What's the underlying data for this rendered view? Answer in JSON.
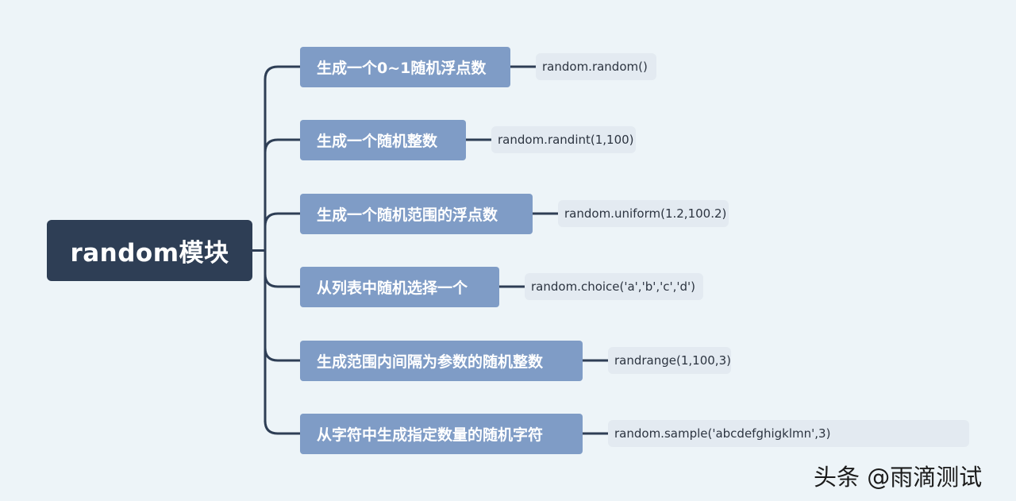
{
  "root": {
    "label": "random模块"
  },
  "branches": [
    {
      "label": "生成一个0~1随机浮点数",
      "code": "random.random()"
    },
    {
      "label": "生成一个随机整数",
      "code": "random.randint(1,100)"
    },
    {
      "label": "生成一个随机范围的浮点数",
      "code": "random.uniform(1.2,100.2)"
    },
    {
      "label": "从列表中随机选择一个",
      "code": "random.choice('a','b','c','d')"
    },
    {
      "label": "生成范围内间隔为参数的随机整数",
      "code": "randrange(1,100,3)"
    },
    {
      "label": "从字符中生成指定数量的随机字符",
      "code": "random.sample('abcdefghigklmn',3)"
    }
  ],
  "watermark": "头条 @雨滴测试",
  "colors": {
    "background": "#edf4f8",
    "root": "#2e3e55",
    "branch": "#7f9cc6",
    "leaf": "#e3eaf1",
    "connector": "#2e3e55"
  }
}
